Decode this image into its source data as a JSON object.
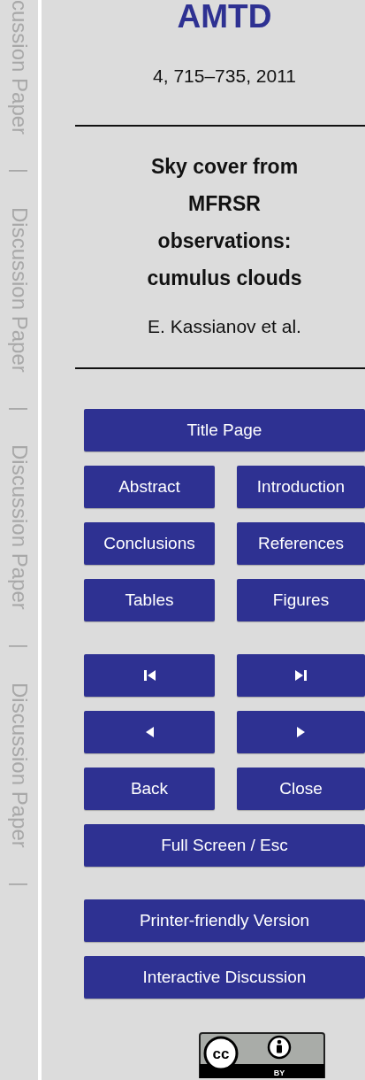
{
  "margin_labels": [
    {
      "text": "cussion Paper",
      "kind": "label"
    },
    {
      "text": "|",
      "kind": "bar"
    },
    {
      "text": "Discussion Paper",
      "kind": "label"
    },
    {
      "text": "|",
      "kind": "bar"
    },
    {
      "text": "Discussion Paper",
      "kind": "label"
    },
    {
      "text": "|",
      "kind": "bar"
    },
    {
      "text": "Discussion Paper",
      "kind": "label"
    },
    {
      "text": "|",
      "kind": "bar"
    }
  ],
  "journal": "AMTD",
  "citation": "4, 715–735, 2011",
  "title": "Sky cover from MFRSR observations: cumulus clouds",
  "authors": "E. Kassianov et al.",
  "button_groups": [
    [
      {
        "kind": "text",
        "label": "Title Page"
      }
    ],
    [
      {
        "kind": "text",
        "label": "Abstract"
      },
      {
        "kind": "text",
        "label": "Introduction"
      }
    ],
    [
      {
        "kind": "text",
        "label": "Conclusions"
      },
      {
        "kind": "text",
        "label": "References"
      }
    ],
    [
      {
        "kind": "text",
        "label": "Tables"
      },
      {
        "kind": "text",
        "label": "Figures"
      }
    ],
    [
      {
        "kind": "first"
      },
      {
        "kind": "last"
      }
    ],
    [
      {
        "kind": "prev"
      },
      {
        "kind": "next"
      }
    ],
    [
      {
        "kind": "text",
        "label": "Back"
      },
      {
        "kind": "text",
        "label": "Close"
      }
    ],
    [
      {
        "kind": "text",
        "label": "Full Screen / Esc"
      }
    ],
    [
      {
        "kind": "text",
        "label": "Printer-friendly Version"
      }
    ],
    [
      {
        "kind": "text",
        "label": "Interactive Discussion"
      }
    ]
  ],
  "license": {
    "mark": "cc",
    "caption": "BY"
  }
}
